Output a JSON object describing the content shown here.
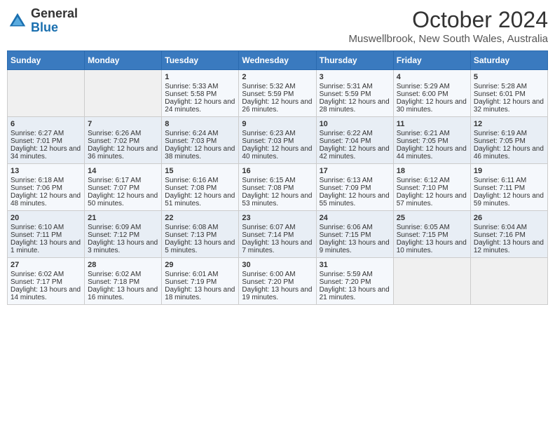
{
  "logo": {
    "line1": "General",
    "line2": "Blue"
  },
  "title": "October 2024",
  "subtitle": "Muswellbrook, New South Wales, Australia",
  "weekdays": [
    "Sunday",
    "Monday",
    "Tuesday",
    "Wednesday",
    "Thursday",
    "Friday",
    "Saturday"
  ],
  "weeks": [
    [
      {
        "day": "",
        "sunrise": "",
        "sunset": "",
        "daylight": ""
      },
      {
        "day": "",
        "sunrise": "",
        "sunset": "",
        "daylight": ""
      },
      {
        "day": "1",
        "sunrise": "Sunrise: 5:33 AM",
        "sunset": "Sunset: 5:58 PM",
        "daylight": "Daylight: 12 hours and 24 minutes."
      },
      {
        "day": "2",
        "sunrise": "Sunrise: 5:32 AM",
        "sunset": "Sunset: 5:59 PM",
        "daylight": "Daylight: 12 hours and 26 minutes."
      },
      {
        "day": "3",
        "sunrise": "Sunrise: 5:31 AM",
        "sunset": "Sunset: 5:59 PM",
        "daylight": "Daylight: 12 hours and 28 minutes."
      },
      {
        "day": "4",
        "sunrise": "Sunrise: 5:29 AM",
        "sunset": "Sunset: 6:00 PM",
        "daylight": "Daylight: 12 hours and 30 minutes."
      },
      {
        "day": "5",
        "sunrise": "Sunrise: 5:28 AM",
        "sunset": "Sunset: 6:01 PM",
        "daylight": "Daylight: 12 hours and 32 minutes."
      }
    ],
    [
      {
        "day": "6",
        "sunrise": "Sunrise: 6:27 AM",
        "sunset": "Sunset: 7:01 PM",
        "daylight": "Daylight: 12 hours and 34 minutes."
      },
      {
        "day": "7",
        "sunrise": "Sunrise: 6:26 AM",
        "sunset": "Sunset: 7:02 PM",
        "daylight": "Daylight: 12 hours and 36 minutes."
      },
      {
        "day": "8",
        "sunrise": "Sunrise: 6:24 AM",
        "sunset": "Sunset: 7:03 PM",
        "daylight": "Daylight: 12 hours and 38 minutes."
      },
      {
        "day": "9",
        "sunrise": "Sunrise: 6:23 AM",
        "sunset": "Sunset: 7:03 PM",
        "daylight": "Daylight: 12 hours and 40 minutes."
      },
      {
        "day": "10",
        "sunrise": "Sunrise: 6:22 AM",
        "sunset": "Sunset: 7:04 PM",
        "daylight": "Daylight: 12 hours and 42 minutes."
      },
      {
        "day": "11",
        "sunrise": "Sunrise: 6:21 AM",
        "sunset": "Sunset: 7:05 PM",
        "daylight": "Daylight: 12 hours and 44 minutes."
      },
      {
        "day": "12",
        "sunrise": "Sunrise: 6:19 AM",
        "sunset": "Sunset: 7:05 PM",
        "daylight": "Daylight: 12 hours and 46 minutes."
      }
    ],
    [
      {
        "day": "13",
        "sunrise": "Sunrise: 6:18 AM",
        "sunset": "Sunset: 7:06 PM",
        "daylight": "Daylight: 12 hours and 48 minutes."
      },
      {
        "day": "14",
        "sunrise": "Sunrise: 6:17 AM",
        "sunset": "Sunset: 7:07 PM",
        "daylight": "Daylight: 12 hours and 50 minutes."
      },
      {
        "day": "15",
        "sunrise": "Sunrise: 6:16 AM",
        "sunset": "Sunset: 7:08 PM",
        "daylight": "Daylight: 12 hours and 51 minutes."
      },
      {
        "day": "16",
        "sunrise": "Sunrise: 6:15 AM",
        "sunset": "Sunset: 7:08 PM",
        "daylight": "Daylight: 12 hours and 53 minutes."
      },
      {
        "day": "17",
        "sunrise": "Sunrise: 6:13 AM",
        "sunset": "Sunset: 7:09 PM",
        "daylight": "Daylight: 12 hours and 55 minutes."
      },
      {
        "day": "18",
        "sunrise": "Sunrise: 6:12 AM",
        "sunset": "Sunset: 7:10 PM",
        "daylight": "Daylight: 12 hours and 57 minutes."
      },
      {
        "day": "19",
        "sunrise": "Sunrise: 6:11 AM",
        "sunset": "Sunset: 7:11 PM",
        "daylight": "Daylight: 12 hours and 59 minutes."
      }
    ],
    [
      {
        "day": "20",
        "sunrise": "Sunrise: 6:10 AM",
        "sunset": "Sunset: 7:11 PM",
        "daylight": "Daylight: 13 hours and 1 minute."
      },
      {
        "day": "21",
        "sunrise": "Sunrise: 6:09 AM",
        "sunset": "Sunset: 7:12 PM",
        "daylight": "Daylight: 13 hours and 3 minutes."
      },
      {
        "day": "22",
        "sunrise": "Sunrise: 6:08 AM",
        "sunset": "Sunset: 7:13 PM",
        "daylight": "Daylight: 13 hours and 5 minutes."
      },
      {
        "day": "23",
        "sunrise": "Sunrise: 6:07 AM",
        "sunset": "Sunset: 7:14 PM",
        "daylight": "Daylight: 13 hours and 7 minutes."
      },
      {
        "day": "24",
        "sunrise": "Sunrise: 6:06 AM",
        "sunset": "Sunset: 7:15 PM",
        "daylight": "Daylight: 13 hours and 9 minutes."
      },
      {
        "day": "25",
        "sunrise": "Sunrise: 6:05 AM",
        "sunset": "Sunset: 7:15 PM",
        "daylight": "Daylight: 13 hours and 10 minutes."
      },
      {
        "day": "26",
        "sunrise": "Sunrise: 6:04 AM",
        "sunset": "Sunset: 7:16 PM",
        "daylight": "Daylight: 13 hours and 12 minutes."
      }
    ],
    [
      {
        "day": "27",
        "sunrise": "Sunrise: 6:02 AM",
        "sunset": "Sunset: 7:17 PM",
        "daylight": "Daylight: 13 hours and 14 minutes."
      },
      {
        "day": "28",
        "sunrise": "Sunrise: 6:02 AM",
        "sunset": "Sunset: 7:18 PM",
        "daylight": "Daylight: 13 hours and 16 minutes."
      },
      {
        "day": "29",
        "sunrise": "Sunrise: 6:01 AM",
        "sunset": "Sunset: 7:19 PM",
        "daylight": "Daylight: 13 hours and 18 minutes."
      },
      {
        "day": "30",
        "sunrise": "Sunrise: 6:00 AM",
        "sunset": "Sunset: 7:20 PM",
        "daylight": "Daylight: 13 hours and 19 minutes."
      },
      {
        "day": "31",
        "sunrise": "Sunrise: 5:59 AM",
        "sunset": "Sunset: 7:20 PM",
        "daylight": "Daylight: 13 hours and 21 minutes."
      },
      {
        "day": "",
        "sunrise": "",
        "sunset": "",
        "daylight": ""
      },
      {
        "day": "",
        "sunrise": "",
        "sunset": "",
        "daylight": ""
      }
    ]
  ]
}
